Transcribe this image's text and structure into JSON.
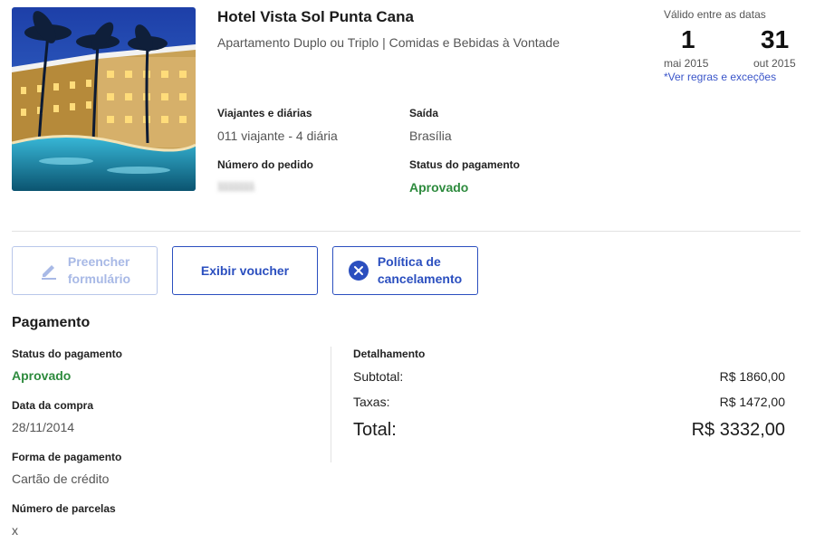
{
  "hotel": {
    "name": "Hotel Vista Sol Punta Cana",
    "description": "Apartamento Duplo ou Triplo | Comidas e Bebidas à Vontade"
  },
  "validity": {
    "caption": "Válido entre as datas",
    "start_day": "1",
    "start_month_year": "mai 2015",
    "end_day": "31",
    "end_month_year": "out 2015",
    "rules_link": "*Ver regras e exceções"
  },
  "order": {
    "travelers_label": "Viajantes e diárias",
    "travelers_value": "011 viajante - 4 diária",
    "departure_label": "Saída",
    "departure_value": "Brasília",
    "order_number_label": "Número do pedido",
    "order_number_value": "1111111",
    "payment_status_label": "Status do pagamento",
    "payment_status_value": "Aprovado"
  },
  "actions": {
    "fill_form": "Preencher formulário",
    "fill_form_line1": "Preencher",
    "fill_form_line2": "formulário",
    "voucher": "Exibir voucher",
    "cancel_line1": "Política de",
    "cancel_line2": "cancelamento"
  },
  "payment": {
    "title": "Pagamento",
    "status_label": "Status do pagamento",
    "status_value": "Aprovado",
    "purchase_date_label": "Data da compra",
    "purchase_date_value": "28/11/2014",
    "method_label": "Forma de pagamento",
    "method_value": "Cartão de crédito",
    "installments_label": "Número de parcelas",
    "installments_value": "x"
  },
  "breakdown": {
    "title": "Detalhamento",
    "subtotal_label": "Subtotal:",
    "subtotal_value": "R$ 1860,00",
    "taxes_label": "Taxas:",
    "taxes_value": "R$ 1472,00",
    "total_label": "Total:",
    "total_value": "R$ 3332,00"
  },
  "colors": {
    "accent": "#2b4fbf",
    "approved": "#2e8b3e",
    "link": "#3a55c9"
  }
}
